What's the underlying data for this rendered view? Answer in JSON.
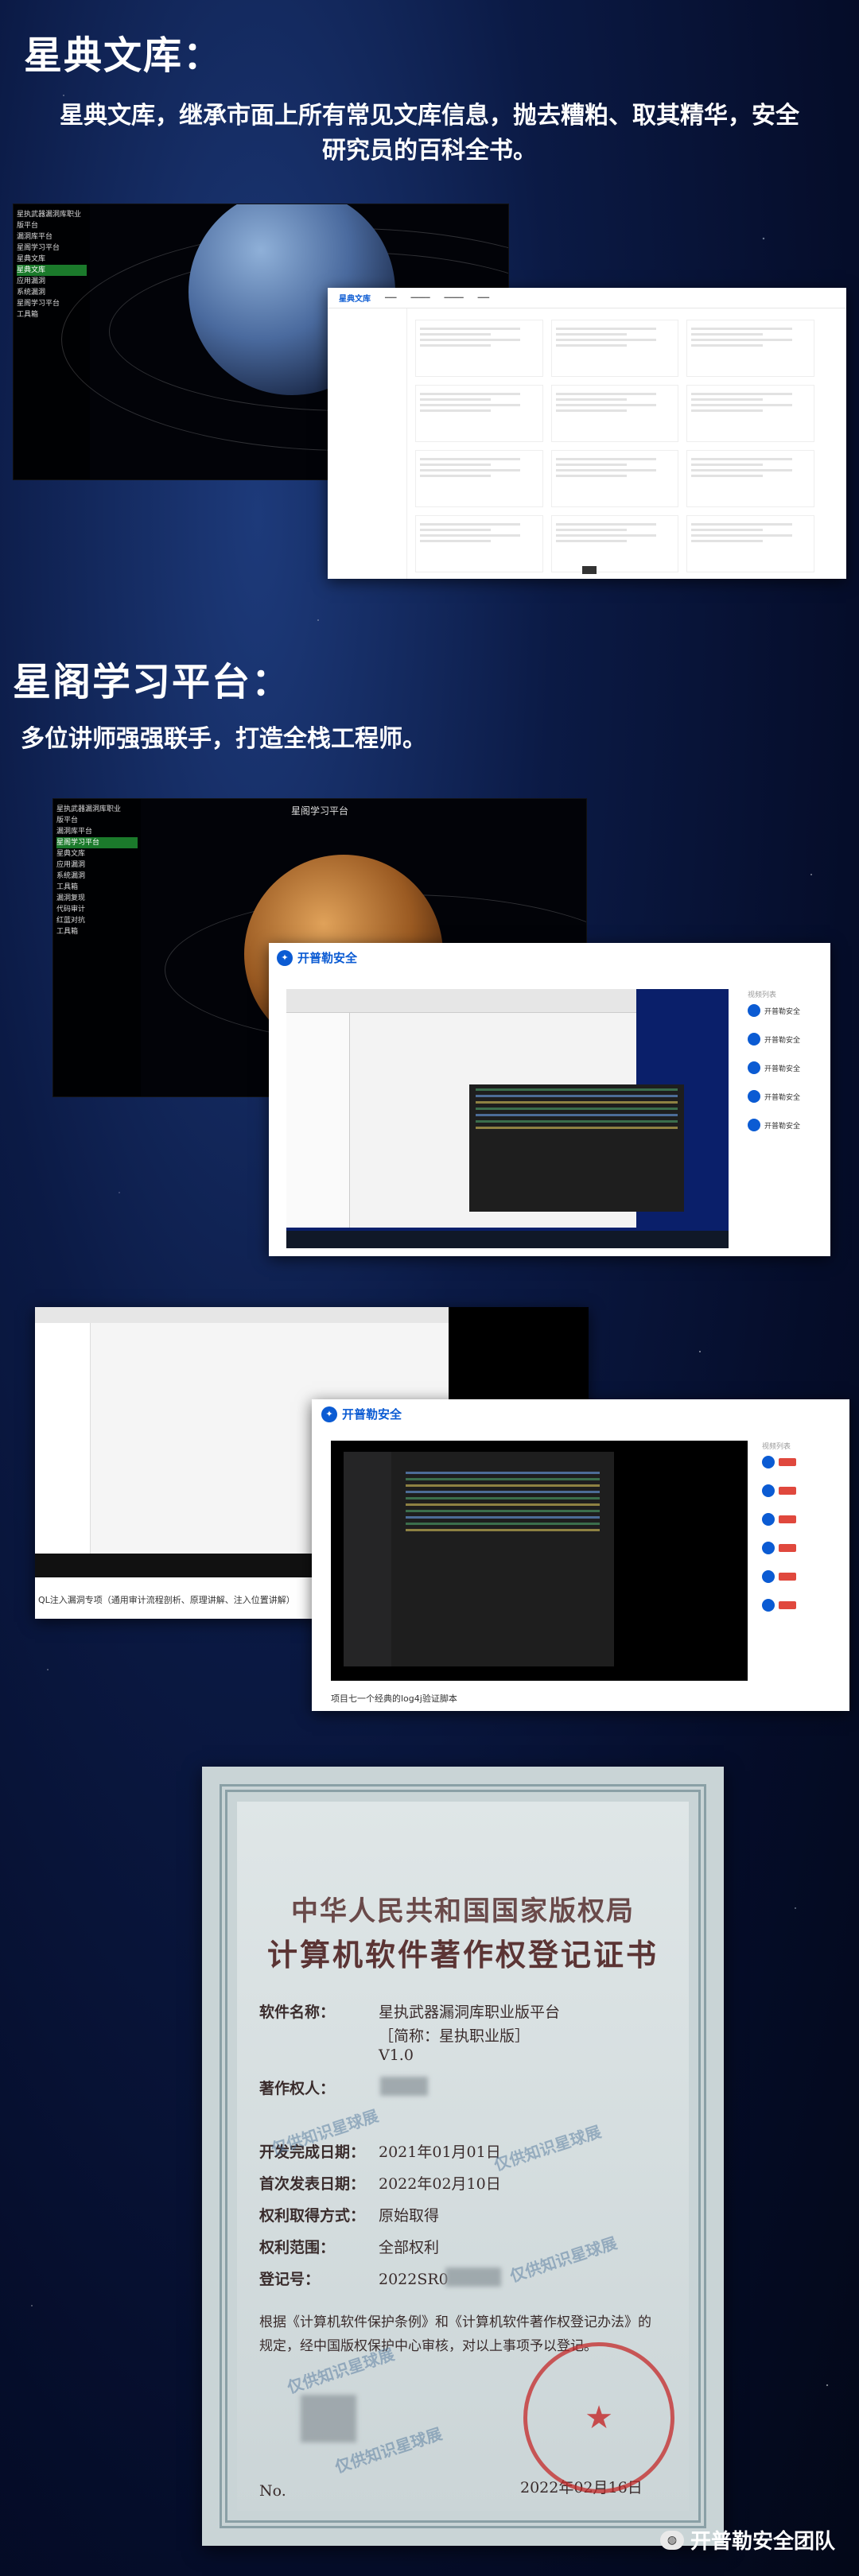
{
  "section1": {
    "title": "星典文库：",
    "subtitle_line1": "星典文库，继承市面上所有常见文库信息，抛去糟粕、取其精华，安全",
    "subtitle_line2": "研究员的百科全书。",
    "dark_window_title": "星典文库",
    "lib_header_brand": "星典文库"
  },
  "section2": {
    "title": "星阁学习平台：",
    "subtitle": "多位讲师强强联手，打造全栈工程师。",
    "dark_window_title": "星阁学习平台",
    "brand": "开普勒安全",
    "related_header": "视频列表"
  },
  "section3": {
    "brand": "开普勒安全",
    "related_header": "视频列表",
    "caption_left": "QL注入漏洞专项（通用审计流程剖析、原理讲解、注入位置讲解）",
    "caption_right": "项目七一个经典的log4j验证脚本"
  },
  "certificate": {
    "title1": "中华人民共和国国家版权局",
    "title2": "计算机软件著作权登记证书",
    "software_name_label": "软件名称：",
    "software_name": "星执武器漏洞库职业版平台",
    "short_name": "［简称：星执职业版］",
    "version": "V1.0",
    "owner_label": "著作权人：",
    "dev_date_label": "开发完成日期：",
    "dev_date": "2021年01月01日",
    "pub_date_label": "首次发表日期：",
    "pub_date": "2022年02月10日",
    "rights_method_label": "权利取得方式：",
    "rights_method": "原始取得",
    "rights_scope_label": "权利范围：",
    "rights_scope": "全部权利",
    "reg_no_label": "登记号：",
    "reg_no": "2022SR0",
    "para1": "根据《计算机软件保护条例》和《计算机软件著作权登记办法》的",
    "para2": "规定，经中国版权保护中心审核，对以上事项予以登记。",
    "no_label": "No.",
    "issue_date": "2022年02月16日",
    "watermark": "仅供知识星球展"
  },
  "footer": {
    "text": "开普勒安全团队"
  }
}
